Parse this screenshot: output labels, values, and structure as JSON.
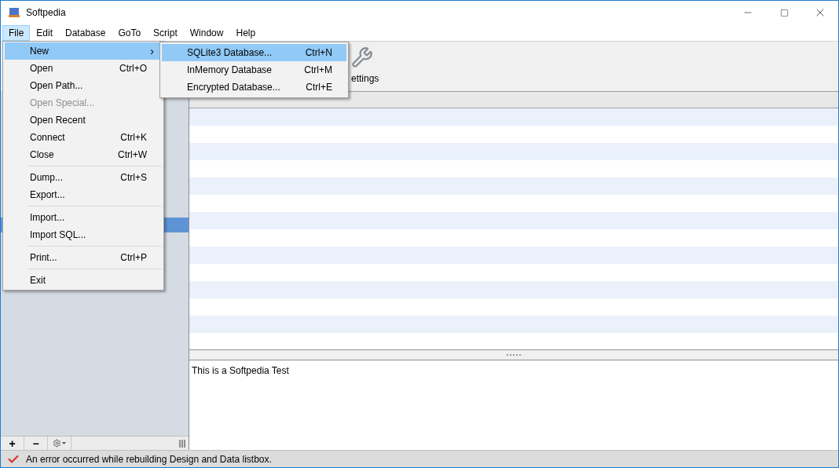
{
  "window": {
    "title": "Softpedia"
  },
  "menu_bar": [
    {
      "label": "File",
      "selected": true
    },
    {
      "label": "Edit",
      "selected": false
    },
    {
      "label": "Database",
      "selected": false
    },
    {
      "label": "GoTo",
      "selected": false
    },
    {
      "label": "Script",
      "selected": false
    },
    {
      "label": "Window",
      "selected": false
    },
    {
      "label": "Help",
      "selected": false
    }
  ],
  "file_menu": [
    {
      "kind": "item",
      "label": "New",
      "arrow": "›",
      "selected": true,
      "disabled": false
    },
    {
      "kind": "item",
      "label": "Open",
      "shortcut": "Ctrl+O",
      "selected": false,
      "disabled": false
    },
    {
      "kind": "item",
      "label": "Open Path...",
      "selected": false,
      "disabled": false
    },
    {
      "kind": "item",
      "label": "Open Special...",
      "selected": false,
      "disabled": true
    },
    {
      "kind": "item",
      "label": "Open Recent",
      "selected": false,
      "disabled": false
    },
    {
      "kind": "item",
      "label": "Connect",
      "shortcut": "Ctrl+K",
      "selected": false,
      "disabled": false
    },
    {
      "kind": "item",
      "label": "Close",
      "shortcut": "Ctrl+W",
      "selected": false,
      "disabled": false
    },
    {
      "kind": "separator"
    },
    {
      "kind": "item",
      "label": "Dump...",
      "shortcut": "Ctrl+S",
      "selected": false,
      "disabled": false
    },
    {
      "kind": "item",
      "label": "Export...",
      "selected": false,
      "disabled": false
    },
    {
      "kind": "separator"
    },
    {
      "kind": "item",
      "label": "Import...",
      "selected": false,
      "disabled": false
    },
    {
      "kind": "item",
      "label": "Import SQL...",
      "selected": false,
      "disabled": false
    },
    {
      "kind": "separator"
    },
    {
      "kind": "item",
      "label": "Print...",
      "shortcut": "Ctrl+P",
      "selected": false,
      "disabled": false
    },
    {
      "kind": "separator"
    },
    {
      "kind": "item",
      "label": "Exit",
      "selected": false,
      "disabled": false
    }
  ],
  "new_submenu": [
    {
      "label": "SQLite3 Database...",
      "shortcut": "Ctrl+N",
      "selected": true
    },
    {
      "label": "InMemory Database",
      "shortcut": "Ctrl+M",
      "selected": false
    },
    {
      "label": "Encrypted Database...",
      "shortcut": "Ctrl+E",
      "selected": false
    }
  ],
  "toolbar": [
    {
      "label": "ettings"
    }
  ],
  "sidebar_buttons": [
    "+",
    "−"
  ],
  "editor": {
    "text": "This is a Softpedia Test"
  },
  "status_bar": {
    "message": "An error occurred while rebuilding Design and Data listbox."
  }
}
